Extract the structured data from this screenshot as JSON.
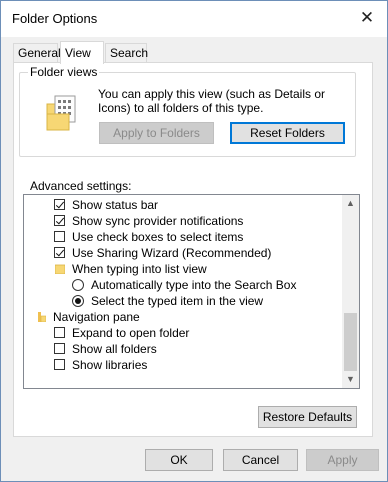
{
  "window": {
    "title": "Folder Options"
  },
  "tabs": [
    {
      "label": "General",
      "active": false
    },
    {
      "label": "View",
      "active": true
    },
    {
      "label": "Search",
      "active": false
    }
  ],
  "folder_views": {
    "group_label": "Folder views",
    "description": "You can apply this view (such as Details or Icons) to all folders of this type.",
    "apply_label": "Apply to Folders",
    "reset_label": "Reset Folders"
  },
  "advanced": {
    "label": "Advanced settings:",
    "items": [
      {
        "kind": "checkbox",
        "label": "Show status bar",
        "checked": true
      },
      {
        "kind": "checkbox",
        "label": "Show sync provider notifications",
        "checked": true
      },
      {
        "kind": "checkbox",
        "label": "Use check boxes to select items",
        "checked": false
      },
      {
        "kind": "checkbox",
        "label": "Use Sharing Wizard (Recommended)",
        "checked": true
      },
      {
        "kind": "folder",
        "label": "When typing into list view"
      },
      {
        "kind": "radio",
        "label": "Automatically type into the Search Box",
        "checked": false
      },
      {
        "kind": "radio",
        "label": "Select the typed item in the view",
        "checked": true
      },
      {
        "kind": "nav",
        "label": "Navigation pane"
      },
      {
        "kind": "checkbox",
        "label": "Expand to open folder",
        "checked": false
      },
      {
        "kind": "checkbox",
        "label": "Show all folders",
        "checked": false
      },
      {
        "kind": "checkbox",
        "label": "Show libraries",
        "checked": false
      }
    ]
  },
  "restore_label": "Restore Defaults",
  "buttons": {
    "ok": "OK",
    "cancel": "Cancel",
    "apply": "Apply"
  },
  "colors": {
    "accent": "#0078d7",
    "folder": "#f7d774"
  }
}
